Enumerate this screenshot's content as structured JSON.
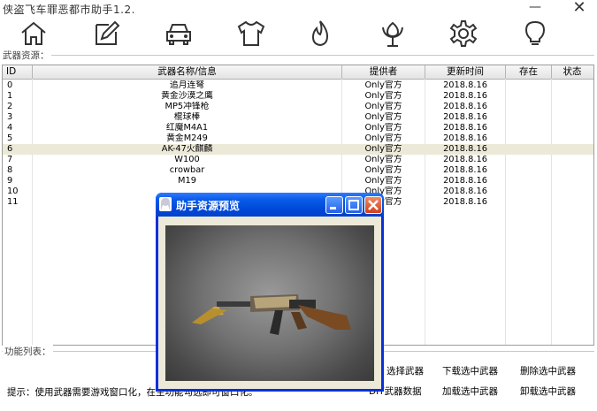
{
  "window": {
    "title": "侠盗飞车罪恶都市助手1.2.",
    "minimize": "—",
    "close": "✕"
  },
  "toolbar": [
    {
      "icon": "home-icon"
    },
    {
      "icon": "edit-icon"
    },
    {
      "icon": "car-icon"
    },
    {
      "icon": "shirt-icon"
    },
    {
      "icon": "flame-icon"
    },
    {
      "icon": "flower-icon"
    },
    {
      "icon": "gear-icon"
    },
    {
      "icon": "lightbulb-icon"
    }
  ],
  "resources_label": "武器资源：",
  "table": {
    "columns": [
      "ID",
      "武器名称/信息",
      "提供者",
      "更新时间",
      "存在",
      "状态"
    ],
    "rows": [
      {
        "id": "0",
        "name": "追月连弩",
        "provider": "Only官方",
        "updated": "2018.8.16",
        "exists": "",
        "status": ""
      },
      {
        "id": "1",
        "name": "黄金沙漠之鹰",
        "provider": "Only官方",
        "updated": "2018.8.16",
        "exists": "",
        "status": ""
      },
      {
        "id": "2",
        "name": "MP5冲锋枪",
        "provider": "Only官方",
        "updated": "2018.8.16",
        "exists": "",
        "status": ""
      },
      {
        "id": "3",
        "name": "棍球棒",
        "provider": "Only官方",
        "updated": "2018.8.16",
        "exists": "",
        "status": ""
      },
      {
        "id": "4",
        "name": "红魔M4A1",
        "provider": "Only官方",
        "updated": "2018.8.16",
        "exists": "",
        "status": ""
      },
      {
        "id": "5",
        "name": "黄金M249",
        "provider": "Only官方",
        "updated": "2018.8.16",
        "exists": "",
        "status": ""
      },
      {
        "id": "6",
        "name": "AK-47火麒麟",
        "provider": "Only官方",
        "updated": "2018.8.16",
        "exists": "",
        "status": ""
      },
      {
        "id": "7",
        "name": "W100",
        "provider": "Only官方",
        "updated": "2018.8.16",
        "exists": "",
        "status": ""
      },
      {
        "id": "8",
        "name": "crowbar",
        "provider": "Only官方",
        "updated": "2018.8.16",
        "exists": "",
        "status": ""
      },
      {
        "id": "9",
        "name": "M19",
        "provider": "Only官方",
        "updated": "2018.8.16",
        "exists": "",
        "status": ""
      },
      {
        "id": "10",
        "name": "",
        "provider": "Only官方",
        "updated": "2018.8.16",
        "exists": "",
        "status": ""
      },
      {
        "id": "11",
        "name": "",
        "provider": "Only官方",
        "updated": "2018.8.16",
        "exists": "",
        "status": ""
      }
    ],
    "selected_index": 6
  },
  "functions_label": "功能列表：",
  "actions": {
    "select_weapon": "选择武器",
    "download_selected": "下载选中武器",
    "delete_selected": "删除选中武器",
    "diy_data": "DIY武器数据",
    "load_selected": "加载选中武器",
    "unload_selected": "卸载选中武器"
  },
  "hint": "提示：使用武器需要游戏窗口化，在主功能勾选即可窗口化。",
  "dialog": {
    "title": "助手资源预览",
    "preview": "AK-47火麒麟 preview image"
  },
  "colors": {
    "selected_row": "#ece9d8",
    "dialog_title_bar": "#0a5ae8",
    "action_link": "#000000"
  }
}
